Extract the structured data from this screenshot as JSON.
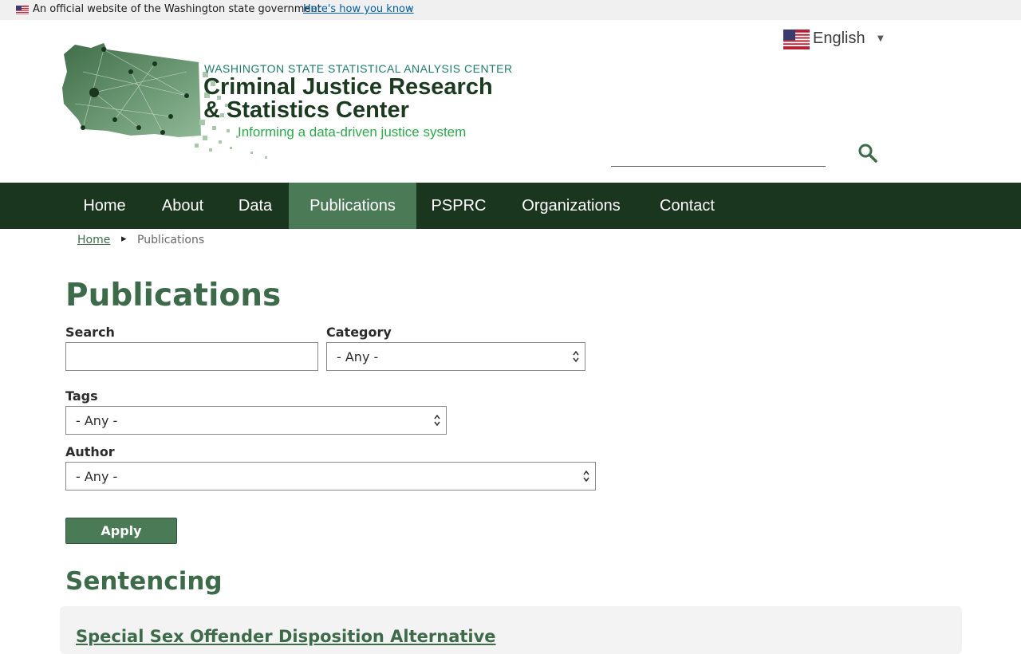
{
  "gov_banner": {
    "text": "An official website of the Washington state government",
    "link": "Here's how you know",
    "flag_icon": "us-flag-icon"
  },
  "header": {
    "kicker": "WASHINGTON STATE STATISTICAL ANALYSIS CENTER",
    "title_line1": "Criminal Justice Research",
    "title_line2": "& Statistics Center",
    "tagline": "Informing a data-driven justice system",
    "language": "English",
    "search_icon": "search-icon"
  },
  "nav": {
    "items": [
      "Home",
      "About",
      "Data",
      "Publications",
      "PSPRC",
      "Organizations",
      "Contact"
    ],
    "active": "Publications"
  },
  "breadcrumb": {
    "home": "Home",
    "current": "Publications"
  },
  "page": {
    "title": "Publications"
  },
  "filters": {
    "search_label": "Search",
    "search_value": "",
    "category_label": "Category",
    "category_value": "- Any -",
    "tags_label": "Tags",
    "tags_value": "- Any -",
    "author_label": "Author",
    "author_value": "- Any -",
    "apply_label": "Apply"
  },
  "results": {
    "section_heading": "Sentencing",
    "first_item_title": "Special Sex Offender Disposition Alternative"
  },
  "colors": {
    "nav_bg": "#1b361f",
    "nav_active": "#4a7a56",
    "heading_green": "#3d6b4a",
    "link_blue": "#005ea2"
  }
}
